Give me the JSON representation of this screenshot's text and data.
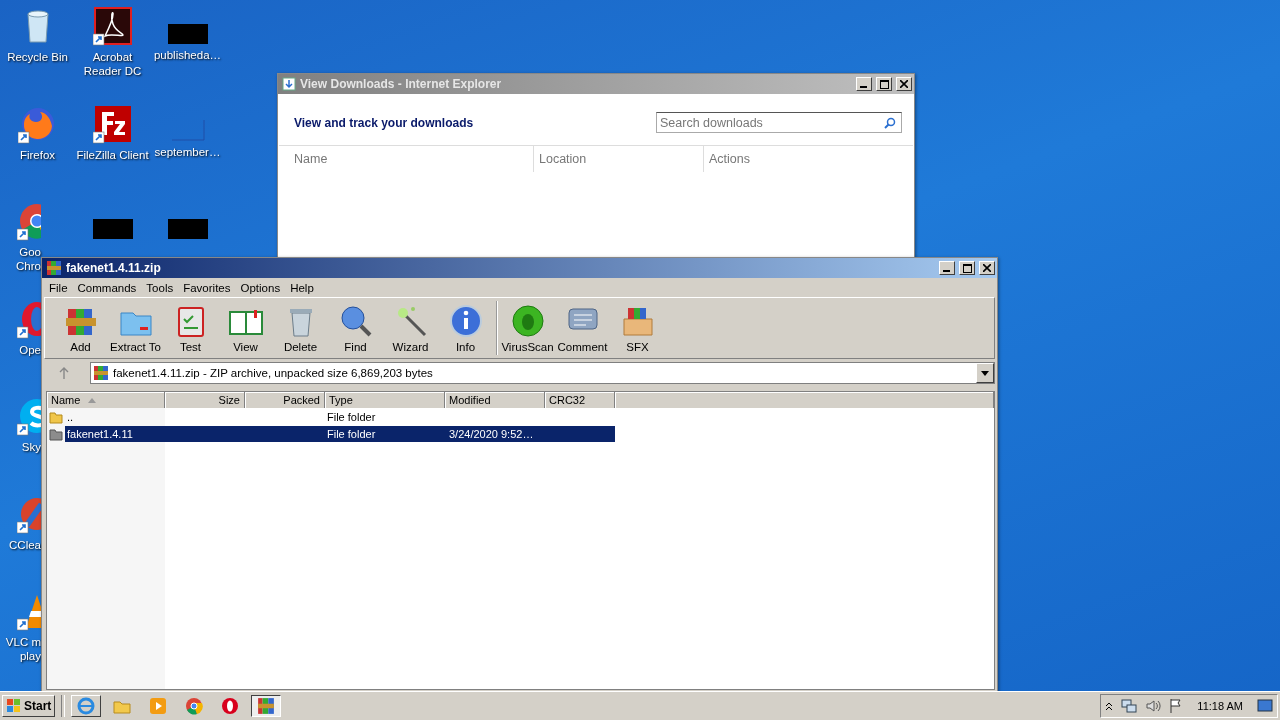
{
  "desktop": {
    "columns": [
      {
        "icons": [
          {
            "kind": "recycle-bin",
            "label": [
              "Recycle Bin"
            ],
            "cut": false
          },
          {
            "kind": "firefox",
            "label": [
              "Firefox"
            ],
            "cut": false
          },
          {
            "kind": "chrome",
            "label": [
              "Goo",
              "Chro"
            ],
            "cut": true
          },
          {
            "kind": "opera",
            "label": [
              "Ope"
            ],
            "cut": true
          },
          {
            "kind": "skype",
            "label": [
              "Sky"
            ],
            "cut": true
          },
          {
            "kind": "ccleaner",
            "label": [
              "CClea"
            ],
            "cut": true
          },
          {
            "kind": "vlc",
            "label": [
              "VLC m",
              "play"
            ],
            "cut": true
          }
        ]
      },
      {
        "icons": [
          {
            "kind": "acrobat",
            "label": [
              "Acrobat",
              "Reader DC"
            ],
            "cut": false
          },
          {
            "kind": "filezilla",
            "label": [
              "FileZilla Client"
            ],
            "cut": false
          },
          {
            "kind": "redacted"
          }
        ]
      },
      {
        "icons": [
          {
            "kind": "redacted",
            "label": [
              "publisheda…"
            ],
            "cut": false
          },
          {
            "kind": "blank",
            "label": [
              "september…"
            ],
            "cut": false
          },
          {
            "kind": "redacted"
          }
        ]
      }
    ]
  },
  "downloads_window": {
    "title": "View Downloads - Internet Explorer",
    "active": false,
    "heading": "View and track your downloads",
    "search": {
      "placeholder": "Search downloads"
    },
    "columns": [
      "Name",
      "Location",
      "Actions"
    ]
  },
  "archive_window": {
    "title": "fakenet1.4.11.zip",
    "active": true,
    "menu": [
      "File",
      "Commands",
      "Tools",
      "Favorites",
      "Options",
      "Help"
    ],
    "toolbar_groups": [
      {
        "buttons": [
          {
            "kind": "add",
            "label": "Add"
          },
          {
            "kind": "extract",
            "label": "Extract To"
          },
          {
            "kind": "test",
            "label": "Test"
          },
          {
            "kind": "view",
            "label": "View"
          },
          {
            "kind": "delete",
            "label": "Delete"
          },
          {
            "kind": "find",
            "label": "Find"
          },
          {
            "kind": "wizard",
            "label": "Wizard"
          },
          {
            "kind": "info",
            "label": "Info"
          }
        ]
      },
      {
        "buttons": [
          {
            "kind": "virusscan",
            "label": "VirusScan"
          },
          {
            "kind": "comment",
            "label": "Comment"
          },
          {
            "kind": "sfx",
            "label": "SFX"
          }
        ]
      }
    ],
    "address": "fakenet1.4.11.zip - ZIP archive, unpacked size 6,869,203 bytes",
    "columns": [
      {
        "label": "Name",
        "kind": "text",
        "sorted": true
      },
      {
        "label": "Size",
        "kind": "number",
        "sorted": false
      },
      {
        "label": "Packed",
        "kind": "number",
        "sorted": false
      },
      {
        "label": "Type",
        "kind": "text",
        "sorted": false
      },
      {
        "label": "Modified",
        "kind": "text",
        "sorted": false
      },
      {
        "label": "CRC32",
        "kind": "text",
        "sorted": false
      }
    ],
    "rows": [
      {
        "kind": "folder",
        "name": "..",
        "size": "",
        "packed": "",
        "type": "File folder",
        "modified": "",
        "crc": "",
        "selected": false
      },
      {
        "kind": "archive-folder",
        "name": "fakenet1.4.11",
        "size": "",
        "packed": "",
        "type": "File folder",
        "modified": "3/24/2020 9:52…",
        "crc": "",
        "selected": true
      }
    ]
  },
  "taskbar": {
    "start": "Start",
    "apps": [
      {
        "kind": "ie",
        "window": true,
        "selected": false
      },
      {
        "kind": "explorer",
        "window": false,
        "selected": false
      },
      {
        "kind": "media",
        "window": false,
        "selected": false
      },
      {
        "kind": "chrome",
        "window": false,
        "selected": false
      },
      {
        "kind": "opera",
        "window": false,
        "selected": false
      },
      {
        "kind": "winrar",
        "window": true,
        "selected": true
      }
    ],
    "clock": "11:18 AM"
  }
}
